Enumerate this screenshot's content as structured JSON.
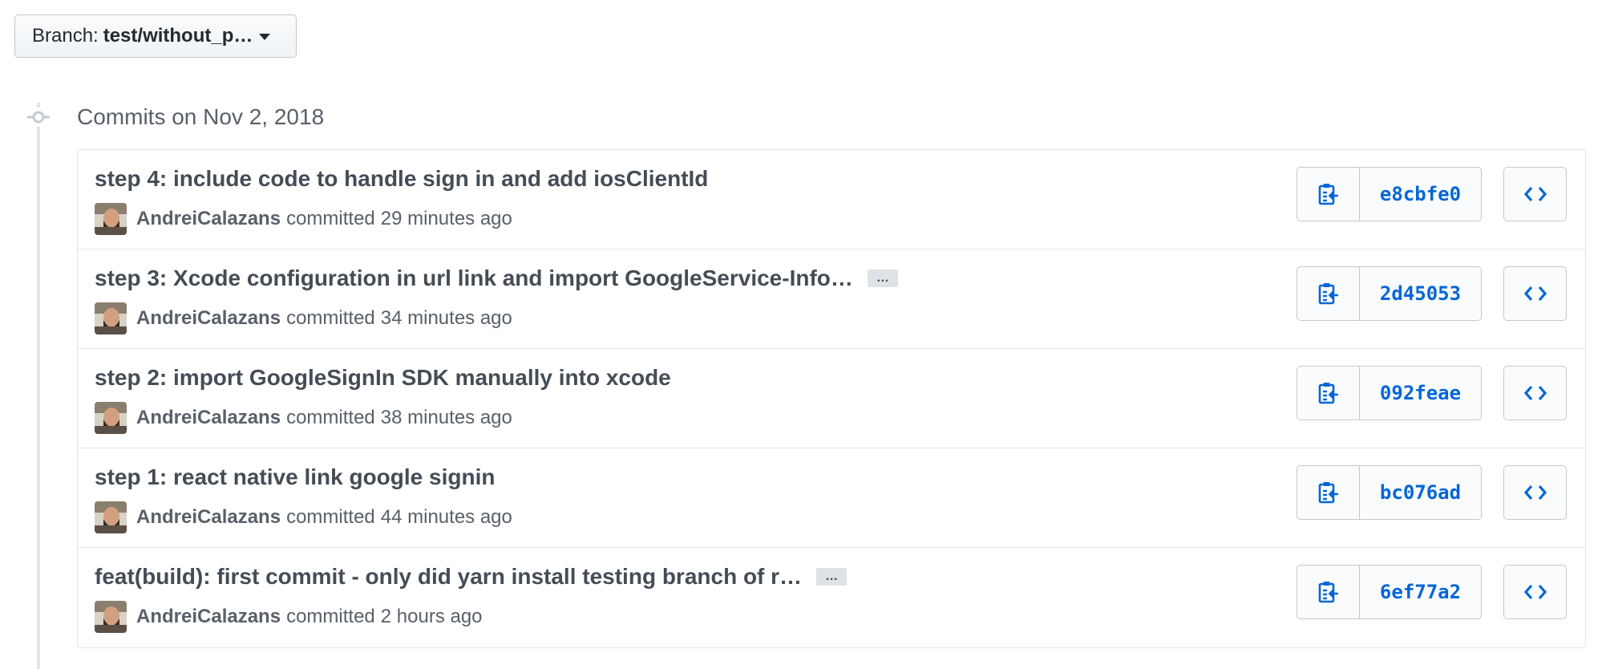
{
  "branch": {
    "prefix": "Branch:",
    "name": "test/without_p…"
  },
  "commits_heading": "Commits on Nov 2, 2018",
  "icons": {
    "timeline": "git-commit-icon",
    "copy": "clippy-icon",
    "browse": "code-icon",
    "more": "ellipsis-icon",
    "branch_caret": "caret-down-icon"
  },
  "colors": {
    "link": "#0366d6",
    "title": "#444d56",
    "meta": "#586069",
    "border": "#e1e4e8"
  },
  "commits": [
    {
      "title": "step 4: include code to handle sign in and add iosClientId",
      "has_more": false,
      "author": "AndreiCalazans",
      "action": "committed",
      "time": "29 minutes ago",
      "sha": "e8cbfe0"
    },
    {
      "title": "step 3: Xcode configuration in url link and import GoogleService-Info…",
      "has_more": true,
      "more_label": "…",
      "author": "AndreiCalazans",
      "action": "committed",
      "time": "34 minutes ago",
      "sha": "2d45053"
    },
    {
      "title": "step 2: import GoogleSignIn SDK manually into xcode",
      "has_more": false,
      "author": "AndreiCalazans",
      "action": "committed",
      "time": "38 minutes ago",
      "sha": "092feae"
    },
    {
      "title": "step 1: react native link google signin",
      "has_more": false,
      "author": "AndreiCalazans",
      "action": "committed",
      "time": "44 minutes ago",
      "sha": "bc076ad"
    },
    {
      "title": "feat(build): first commit - only did yarn install testing branch of r…",
      "has_more": true,
      "more_label": "…",
      "author": "AndreiCalazans",
      "action": "committed",
      "time": "2 hours ago",
      "sha": "6ef77a2"
    }
  ]
}
